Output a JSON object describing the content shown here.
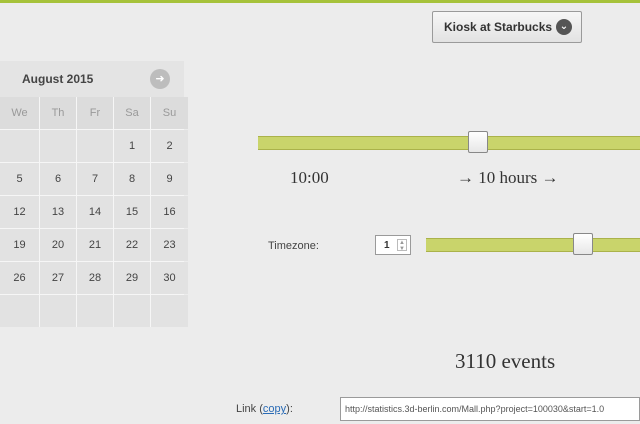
{
  "location": {
    "label": "Kiosk at Starbucks",
    "icon": "chevron-down-icon"
  },
  "calendar": {
    "month_label": "August 2015",
    "next_icon": "arrow-right-icon",
    "weekdays": [
      "We",
      "Th",
      "Fr",
      "Sa",
      "Su"
    ],
    "weeks": [
      [
        "",
        "",
        "",
        "1",
        "2"
      ],
      [
        "5",
        "6",
        "7",
        "8",
        "9"
      ],
      [
        "12",
        "13",
        "14",
        "15",
        "16"
      ],
      [
        "19",
        "20",
        "21",
        "22",
        "23"
      ],
      [
        "26",
        "27",
        "28",
        "29",
        "30"
      ],
      [
        "",
        "",
        "",
        "",
        ""
      ]
    ]
  },
  "time": {
    "start_label": "10:00",
    "duration_label": "→ 10 hours →"
  },
  "timezone": {
    "label": "Timezone:",
    "value": "1"
  },
  "events": {
    "label": "3110 events"
  },
  "link": {
    "label": "Link (",
    "copy_label": "copy",
    "suffix": "):",
    "value": "http://statistics.3d-berlin.com/Mall.php?project=100030&start=1.0"
  },
  "colors": {
    "accent": "#a6c23a",
    "slider": "#c9d46b"
  }
}
